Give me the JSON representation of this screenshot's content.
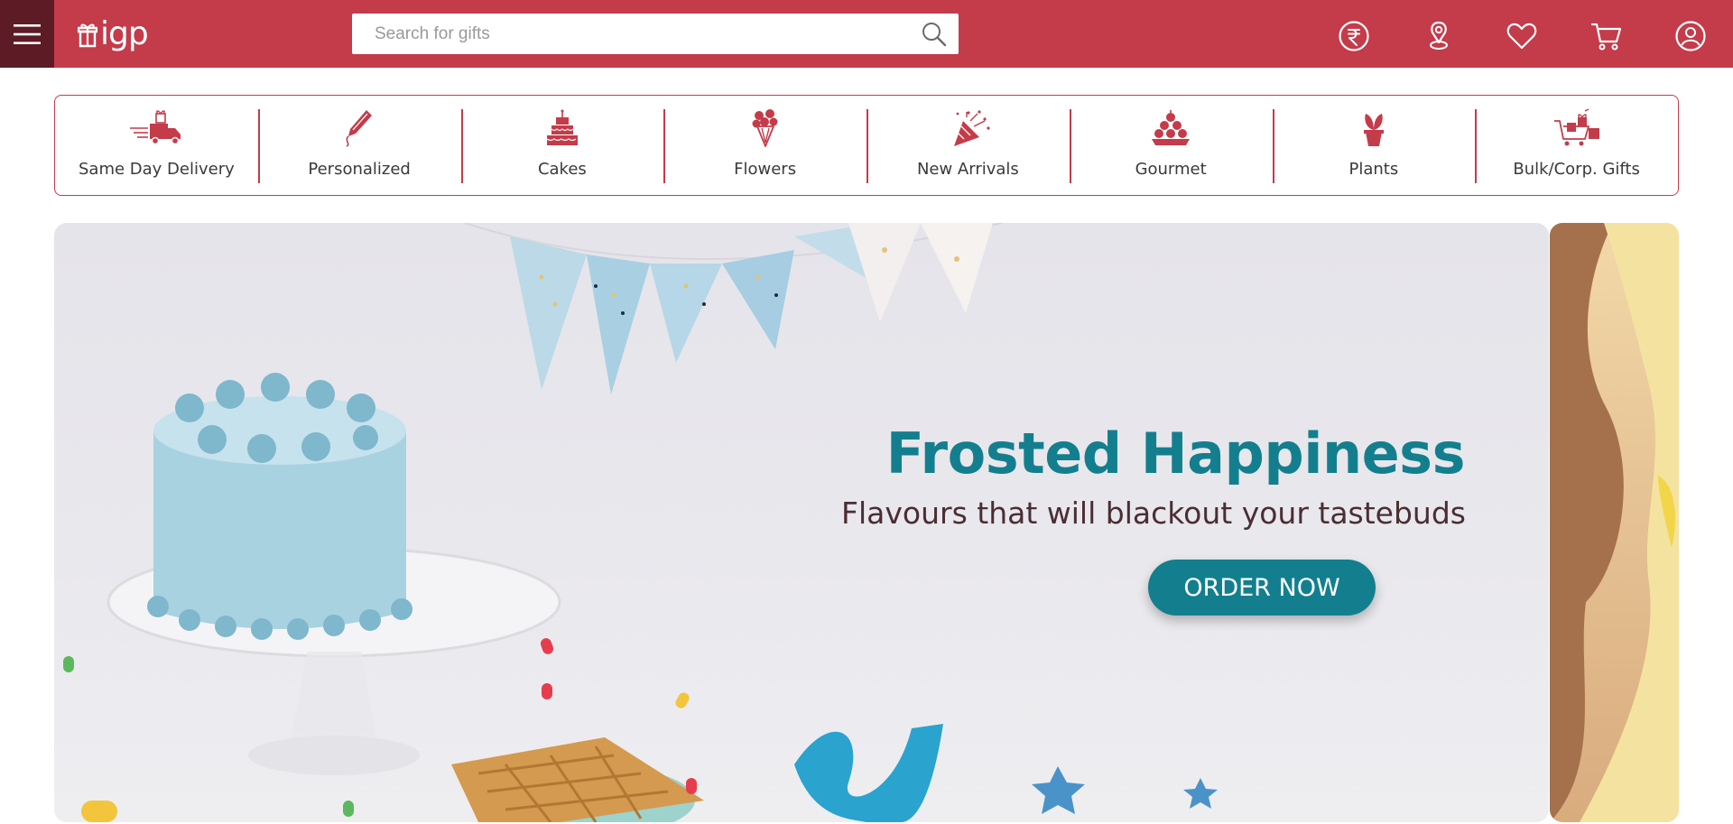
{
  "header": {
    "logo_text": "igp",
    "search_placeholder": "Search for gifts",
    "icons": [
      "menu-icon",
      "search-icon",
      "currency-rupee-icon",
      "location-pin-icon",
      "heart-icon",
      "cart-icon",
      "account-icon"
    ]
  },
  "categories": [
    {
      "label": "Same Day Delivery",
      "icon": "delivery-truck-icon"
    },
    {
      "label": "Personalized",
      "icon": "pencil-icon"
    },
    {
      "label": "Cakes",
      "icon": "cake-icon"
    },
    {
      "label": "Flowers",
      "icon": "bouquet-icon"
    },
    {
      "label": "New Arrivals",
      "icon": "party-popper-icon"
    },
    {
      "label": "Gourmet",
      "icon": "sweets-icon"
    },
    {
      "label": "Plants",
      "icon": "plant-icon"
    },
    {
      "label": "Bulk/Corp. Gifts",
      "icon": "gift-cart-icon"
    }
  ],
  "banner": {
    "headline": "Frosted Happiness",
    "subheadline": "Flavours that will blackout your tastebuds",
    "cta_label": "ORDER NOW"
  },
  "colors": {
    "brand": "#c43b4a",
    "brand_dark": "#5c1b25",
    "banner_accent": "#137f8e",
    "category_text": "#3a3a3a"
  }
}
